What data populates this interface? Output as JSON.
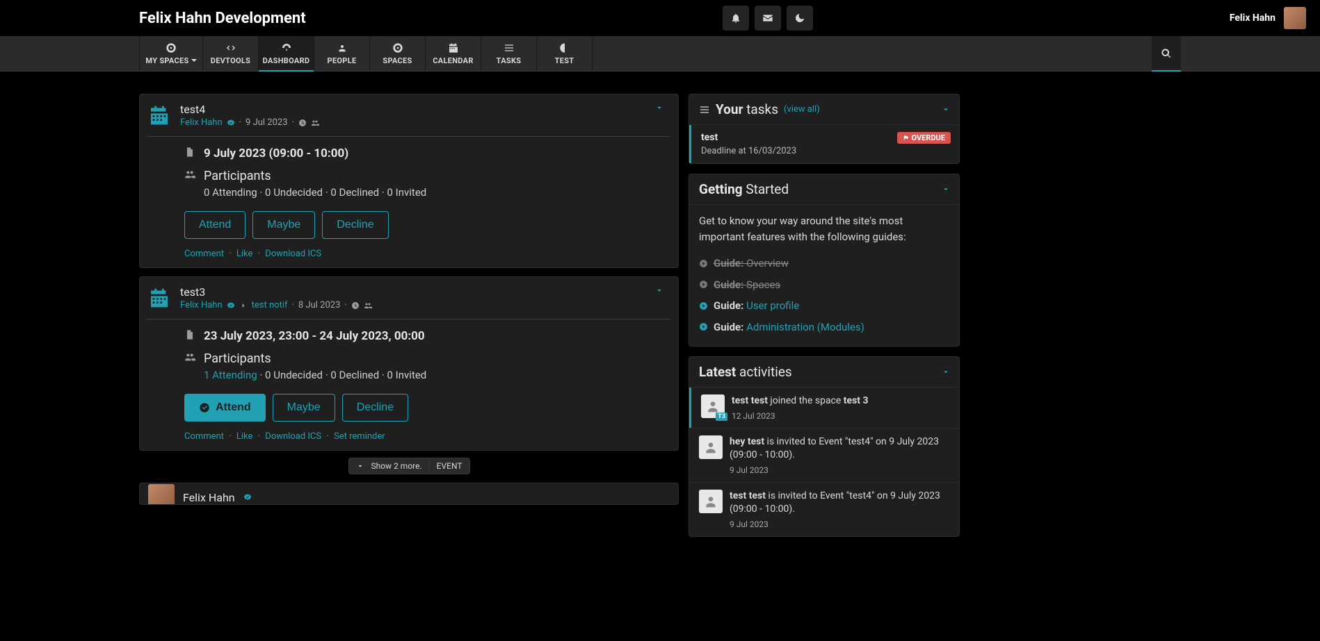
{
  "header": {
    "site_title": "Felix Hahn Development",
    "username": "Felix Hahn"
  },
  "nav": {
    "my_spaces": "MY SPACES",
    "devtools": "DEVTOOLS",
    "dashboard": "DASHBOARD",
    "people": "PEOPLE",
    "spaces": "SPACES",
    "calendar": "CALENDAR",
    "tasks": "TASKS",
    "test": "TEST"
  },
  "events": [
    {
      "title": "test4",
      "author": "Felix Hahn",
      "date_posted": "9 Jul 2023",
      "when": "9 July 2023 (09:00 - 10:00)",
      "participants_label": "Participants",
      "participants_summary": "0 Attending · 0 Undecided · 0 Declined · 0 Invited",
      "attending_link": "",
      "rsvp": {
        "attend": "Attend",
        "maybe": "Maybe",
        "decline": "Decline",
        "attend_selected": false
      },
      "actions": {
        "comment": "Comment",
        "like": "Like",
        "ics": "Download ICS"
      }
    },
    {
      "title": "test3",
      "author": "Felix Hahn",
      "space": "test notif",
      "date_posted": "8 Jul 2023",
      "when": "23 July 2023, 23:00 - 24 July 2023, 00:00",
      "participants_label": "Participants",
      "attending_link": "1 Attending",
      "participants_summary": "· 0 Undecided · 0 Declined · 0 Invited",
      "rsvp": {
        "attend": "Attend",
        "maybe": "Maybe",
        "decline": "Decline",
        "attend_selected": true
      },
      "actions": {
        "comment": "Comment",
        "like": "Like",
        "ics": "Download ICS",
        "reminder": "Set reminder"
      }
    }
  ],
  "show_more": {
    "text": "Show 2 more.",
    "tag": "EVENT"
  },
  "peek": {
    "name": "Felix Hahn"
  },
  "tasks_widget": {
    "title_bold": "Your",
    "title_rest": "tasks",
    "view_all": "(view all)",
    "item": {
      "title": "test",
      "deadline": "Deadline at 16/03/2023",
      "overdue": "OVERDUE"
    }
  },
  "getting_started": {
    "title_bold": "Getting",
    "title_rest": "Started",
    "intro": "Get to know your way around the site's most important features with the following guides:",
    "guides": [
      {
        "bold": "Guide:",
        "label": "Overview",
        "done": true
      },
      {
        "bold": "Guide:",
        "label": "Spaces",
        "done": true
      },
      {
        "bold": "Guide:",
        "label": "User profile",
        "done": false
      },
      {
        "bold": "Guide:",
        "label": "Administration (Modules)",
        "done": false
      }
    ]
  },
  "activities": {
    "title_bold": "Latest",
    "title_rest": "activities",
    "items": [
      {
        "actor": "test test",
        "middle": "joined the space",
        "target": "test 3",
        "tail": "",
        "time": "12 Jul 2023",
        "space_badge": "T3"
      },
      {
        "actor": "hey test",
        "middle": "is invited to Event \"test4\" on 9 July 2023 (09:00 - 10:00).",
        "target": "",
        "tail": "",
        "time": "9 Jul 2023",
        "space_badge": ""
      },
      {
        "actor": "test test",
        "middle": "is invited to Event \"test4\" on 9 July 2023 (09:00 - 10:00).",
        "target": "",
        "tail": "",
        "time": "9 Jul 2023",
        "space_badge": ""
      }
    ]
  }
}
